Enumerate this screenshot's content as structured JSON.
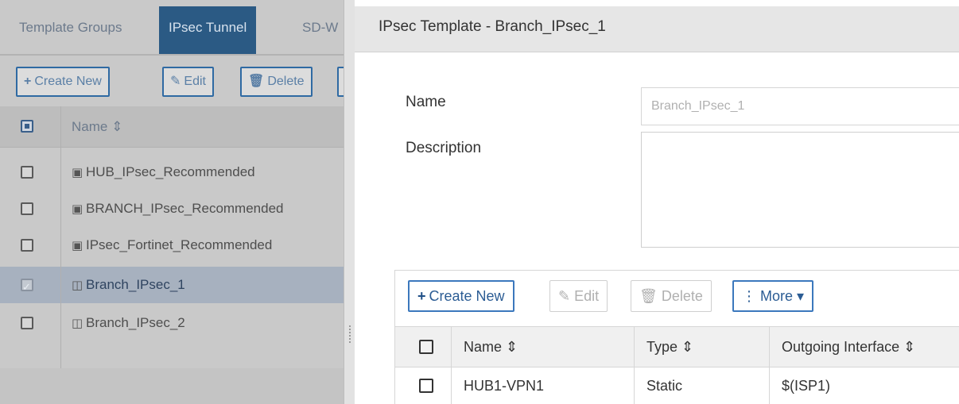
{
  "left": {
    "tabs": [
      {
        "label": "Template Groups"
      },
      {
        "label": "IPsec Tunnel"
      },
      {
        "label": "SD-W"
      }
    ],
    "toolbar": {
      "create_new": "Create New",
      "edit": "Edit",
      "delete": "Delete"
    },
    "table": {
      "name_header": "Name ⇕",
      "rows": [
        {
          "name": "HUB_IPsec_Recommended",
          "icon": "template-recommended-icon"
        },
        {
          "name": "BRANCH_IPsec_Recommended",
          "icon": "template-recommended-icon"
        },
        {
          "name": "IPsec_Fortinet_Recommended",
          "icon": "template-recommended-icon"
        },
        {
          "name": "Branch_IPsec_1",
          "icon": "template-device-icon",
          "selected": true
        },
        {
          "name": "Branch_IPsec_2",
          "icon": "template-device-icon"
        }
      ]
    }
  },
  "panel": {
    "title": "IPsec Template - Branch_IPsec_1",
    "name_label": "Name",
    "name_value": "Branch_IPsec_1",
    "description_label": "Description",
    "toolbar": {
      "create_new": "Create New",
      "edit": "Edit",
      "delete": "Delete",
      "more": "More"
    },
    "tunnels": {
      "headers": {
        "name": "Name ⇕",
        "type": "Type ⇕",
        "outgoing": "Outgoing Interface ⇕"
      },
      "rows": [
        {
          "name": "HUB1-VPN1",
          "type": "Static",
          "outgoing": "$(ISP1)"
        }
      ]
    }
  },
  "colors": {
    "active_tab": "#2b5a84",
    "primary_border": "#3b78bd"
  }
}
